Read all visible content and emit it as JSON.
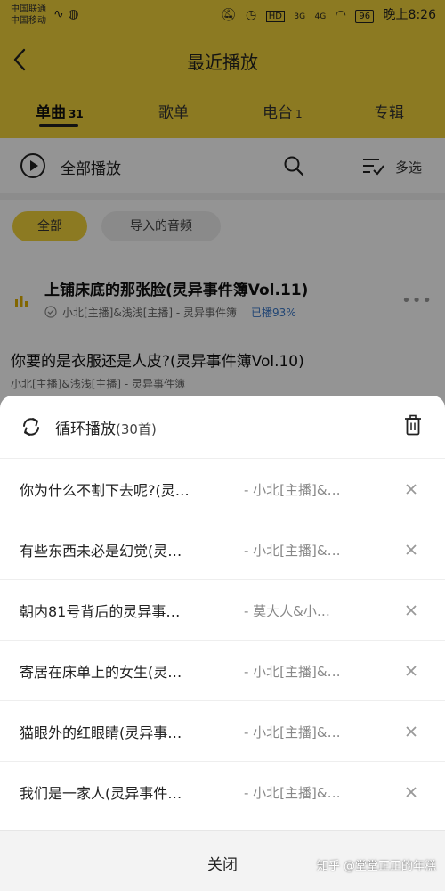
{
  "status_bar": {
    "carrier_1": "中国联通",
    "carrier_2": "中国移动",
    "signal_4g": "4G",
    "signal_3g": "3G",
    "hd": "HD",
    "battery": "96",
    "time": "晚上8:26"
  },
  "header": {
    "title": "最近播放",
    "back_icon": "chevron-left-icon"
  },
  "tabs": [
    {
      "label": "单曲",
      "count": "31",
      "active": true
    },
    {
      "label": "歌单",
      "count": "",
      "active": false
    },
    {
      "label": "电台",
      "count": "1",
      "active": false
    },
    {
      "label": "专辑",
      "count": "",
      "active": false
    }
  ],
  "actions": {
    "play_all": "全部播放",
    "multi_select": "多选"
  },
  "filters": {
    "all": "全部",
    "imported": "导入的音频"
  },
  "song_list": [
    {
      "title": "上铺床底的那张脸(灵异事件簿Vol.11)",
      "meta": "小北[主播]&浅浅[主播] - 灵异事件簿",
      "played": "已播93%"
    },
    {
      "title": "你要的是衣服还是人皮?(灵异事件簿Vol.10)",
      "meta": "小北[主播]&浅浅[主播] - 灵异事件簿",
      "played": ""
    }
  ],
  "sheet": {
    "mode_label": "循环播放",
    "mode_count": "(30首)",
    "queue": [
      {
        "title": "你为什么不割下去呢?(灵…",
        "artist": "- 小北[主播]&…"
      },
      {
        "title": "有些东西未必是幻觉(灵…",
        "artist": "- 小北[主播]&…"
      },
      {
        "title": "朝内81号背后的灵异事…",
        "artist": "- 莫大人&小…"
      },
      {
        "title": "寄居在床单上的女生(灵…",
        "artist": "- 小北[主播]&…"
      },
      {
        "title": "猫眼外的红眼睛(灵异事…",
        "artist": "- 小北[主播]&…"
      },
      {
        "title": "我们是一家人(灵异事件…",
        "artist": "- 小北[主播]&…"
      }
    ],
    "close_label": "关闭"
  },
  "watermark": "知乎 @堂堂正正的年糕",
  "colors": {
    "accent": "#f2d23b",
    "played_blue": "#3a78c8"
  }
}
